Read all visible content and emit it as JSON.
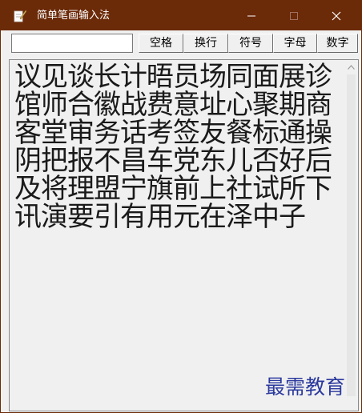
{
  "window": {
    "title": "简单笔画输入法",
    "icons": {
      "app": "feather-pen-icon",
      "minimize": "minimize-icon",
      "maximize": "maximize-icon",
      "close": "close-icon"
    },
    "colors": {
      "titlebar": "#6b2a08",
      "title_text": "#ffffff",
      "body": "#f0f0f0"
    }
  },
  "toolbar": {
    "input_value": "",
    "buttons": [
      {
        "label": "空格"
      },
      {
        "label": "换行"
      },
      {
        "label": "符号"
      },
      {
        "label": "字母"
      },
      {
        "label": "数字"
      }
    ]
  },
  "content": {
    "characters": "议见谈长计晤员场同面展诊馆师合徽战费意址心聚期商客堂审务话考签友餐标通操阴把报不昌车党东儿否好后及将理盟宁旗前上社试所下讯演要引有用元在泽中子",
    "scrollbar_icon": "scroll-up-arrow-icon"
  },
  "watermark": {
    "text": "最需教育",
    "color": "#2c3a9e"
  }
}
